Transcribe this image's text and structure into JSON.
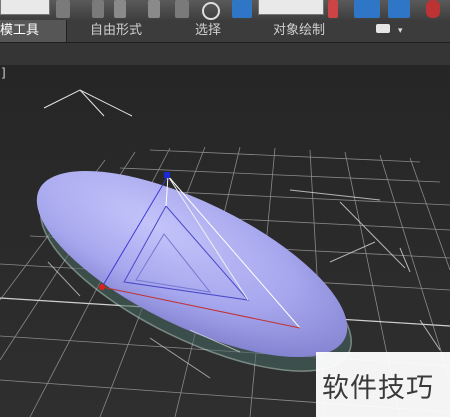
{
  "ribbon": {
    "tabs": [
      {
        "label": "模工具"
      },
      {
        "label": "自由形式"
      },
      {
        "label": "选择"
      },
      {
        "label": "对象绘制"
      }
    ]
  },
  "viewport": {
    "label_fragment": "]"
  },
  "watermark": {
    "text": "软件技巧"
  },
  "colors": {
    "ellipsoid": "#a6a6ee",
    "grid": "#9a9a9a",
    "active_tab": "#565656",
    "toolbar_blue": "#2f77c6"
  }
}
